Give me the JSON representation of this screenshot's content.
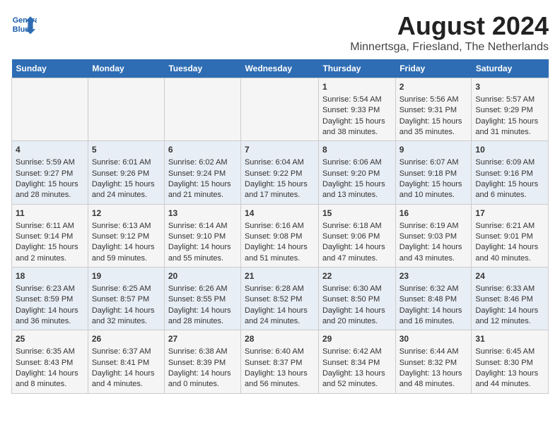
{
  "header": {
    "logo_line1": "General",
    "logo_line2": "Blue",
    "title": "August 2024",
    "subtitle": "Minnertsga, Friesland, The Netherlands"
  },
  "days_of_week": [
    "Sunday",
    "Monday",
    "Tuesday",
    "Wednesday",
    "Thursday",
    "Friday",
    "Saturday"
  ],
  "weeks": [
    [
      {
        "day": "",
        "content": ""
      },
      {
        "day": "",
        "content": ""
      },
      {
        "day": "",
        "content": ""
      },
      {
        "day": "",
        "content": ""
      },
      {
        "day": "1",
        "content": "Sunrise: 5:54 AM\nSunset: 9:33 PM\nDaylight: 15 hours and 38 minutes."
      },
      {
        "day": "2",
        "content": "Sunrise: 5:56 AM\nSunset: 9:31 PM\nDaylight: 15 hours and 35 minutes."
      },
      {
        "day": "3",
        "content": "Sunrise: 5:57 AM\nSunset: 9:29 PM\nDaylight: 15 hours and 31 minutes."
      }
    ],
    [
      {
        "day": "4",
        "content": "Sunrise: 5:59 AM\nSunset: 9:27 PM\nDaylight: 15 hours and 28 minutes."
      },
      {
        "day": "5",
        "content": "Sunrise: 6:01 AM\nSunset: 9:26 PM\nDaylight: 15 hours and 24 minutes."
      },
      {
        "day": "6",
        "content": "Sunrise: 6:02 AM\nSunset: 9:24 PM\nDaylight: 15 hours and 21 minutes."
      },
      {
        "day": "7",
        "content": "Sunrise: 6:04 AM\nSunset: 9:22 PM\nDaylight: 15 hours and 17 minutes."
      },
      {
        "day": "8",
        "content": "Sunrise: 6:06 AM\nSunset: 9:20 PM\nDaylight: 15 hours and 13 minutes."
      },
      {
        "day": "9",
        "content": "Sunrise: 6:07 AM\nSunset: 9:18 PM\nDaylight: 15 hours and 10 minutes."
      },
      {
        "day": "10",
        "content": "Sunrise: 6:09 AM\nSunset: 9:16 PM\nDaylight: 15 hours and 6 minutes."
      }
    ],
    [
      {
        "day": "11",
        "content": "Sunrise: 6:11 AM\nSunset: 9:14 PM\nDaylight: 15 hours and 2 minutes."
      },
      {
        "day": "12",
        "content": "Sunrise: 6:13 AM\nSunset: 9:12 PM\nDaylight: 14 hours and 59 minutes."
      },
      {
        "day": "13",
        "content": "Sunrise: 6:14 AM\nSunset: 9:10 PM\nDaylight: 14 hours and 55 minutes."
      },
      {
        "day": "14",
        "content": "Sunrise: 6:16 AM\nSunset: 9:08 PM\nDaylight: 14 hours and 51 minutes."
      },
      {
        "day": "15",
        "content": "Sunrise: 6:18 AM\nSunset: 9:06 PM\nDaylight: 14 hours and 47 minutes."
      },
      {
        "day": "16",
        "content": "Sunrise: 6:19 AM\nSunset: 9:03 PM\nDaylight: 14 hours and 43 minutes."
      },
      {
        "day": "17",
        "content": "Sunrise: 6:21 AM\nSunset: 9:01 PM\nDaylight: 14 hours and 40 minutes."
      }
    ],
    [
      {
        "day": "18",
        "content": "Sunrise: 6:23 AM\nSunset: 8:59 PM\nDaylight: 14 hours and 36 minutes."
      },
      {
        "day": "19",
        "content": "Sunrise: 6:25 AM\nSunset: 8:57 PM\nDaylight: 14 hours and 32 minutes."
      },
      {
        "day": "20",
        "content": "Sunrise: 6:26 AM\nSunset: 8:55 PM\nDaylight: 14 hours and 28 minutes."
      },
      {
        "day": "21",
        "content": "Sunrise: 6:28 AM\nSunset: 8:52 PM\nDaylight: 14 hours and 24 minutes."
      },
      {
        "day": "22",
        "content": "Sunrise: 6:30 AM\nSunset: 8:50 PM\nDaylight: 14 hours and 20 minutes."
      },
      {
        "day": "23",
        "content": "Sunrise: 6:32 AM\nSunset: 8:48 PM\nDaylight: 14 hours and 16 minutes."
      },
      {
        "day": "24",
        "content": "Sunrise: 6:33 AM\nSunset: 8:46 PM\nDaylight: 14 hours and 12 minutes."
      }
    ],
    [
      {
        "day": "25",
        "content": "Sunrise: 6:35 AM\nSunset: 8:43 PM\nDaylight: 14 hours and 8 minutes."
      },
      {
        "day": "26",
        "content": "Sunrise: 6:37 AM\nSunset: 8:41 PM\nDaylight: 14 hours and 4 minutes."
      },
      {
        "day": "27",
        "content": "Sunrise: 6:38 AM\nSunset: 8:39 PM\nDaylight: 14 hours and 0 minutes."
      },
      {
        "day": "28",
        "content": "Sunrise: 6:40 AM\nSunset: 8:37 PM\nDaylight: 13 hours and 56 minutes."
      },
      {
        "day": "29",
        "content": "Sunrise: 6:42 AM\nSunset: 8:34 PM\nDaylight: 13 hours and 52 minutes."
      },
      {
        "day": "30",
        "content": "Sunrise: 6:44 AM\nSunset: 8:32 PM\nDaylight: 13 hours and 48 minutes."
      },
      {
        "day": "31",
        "content": "Sunrise: 6:45 AM\nSunset: 8:30 PM\nDaylight: 13 hours and 44 minutes."
      }
    ]
  ]
}
